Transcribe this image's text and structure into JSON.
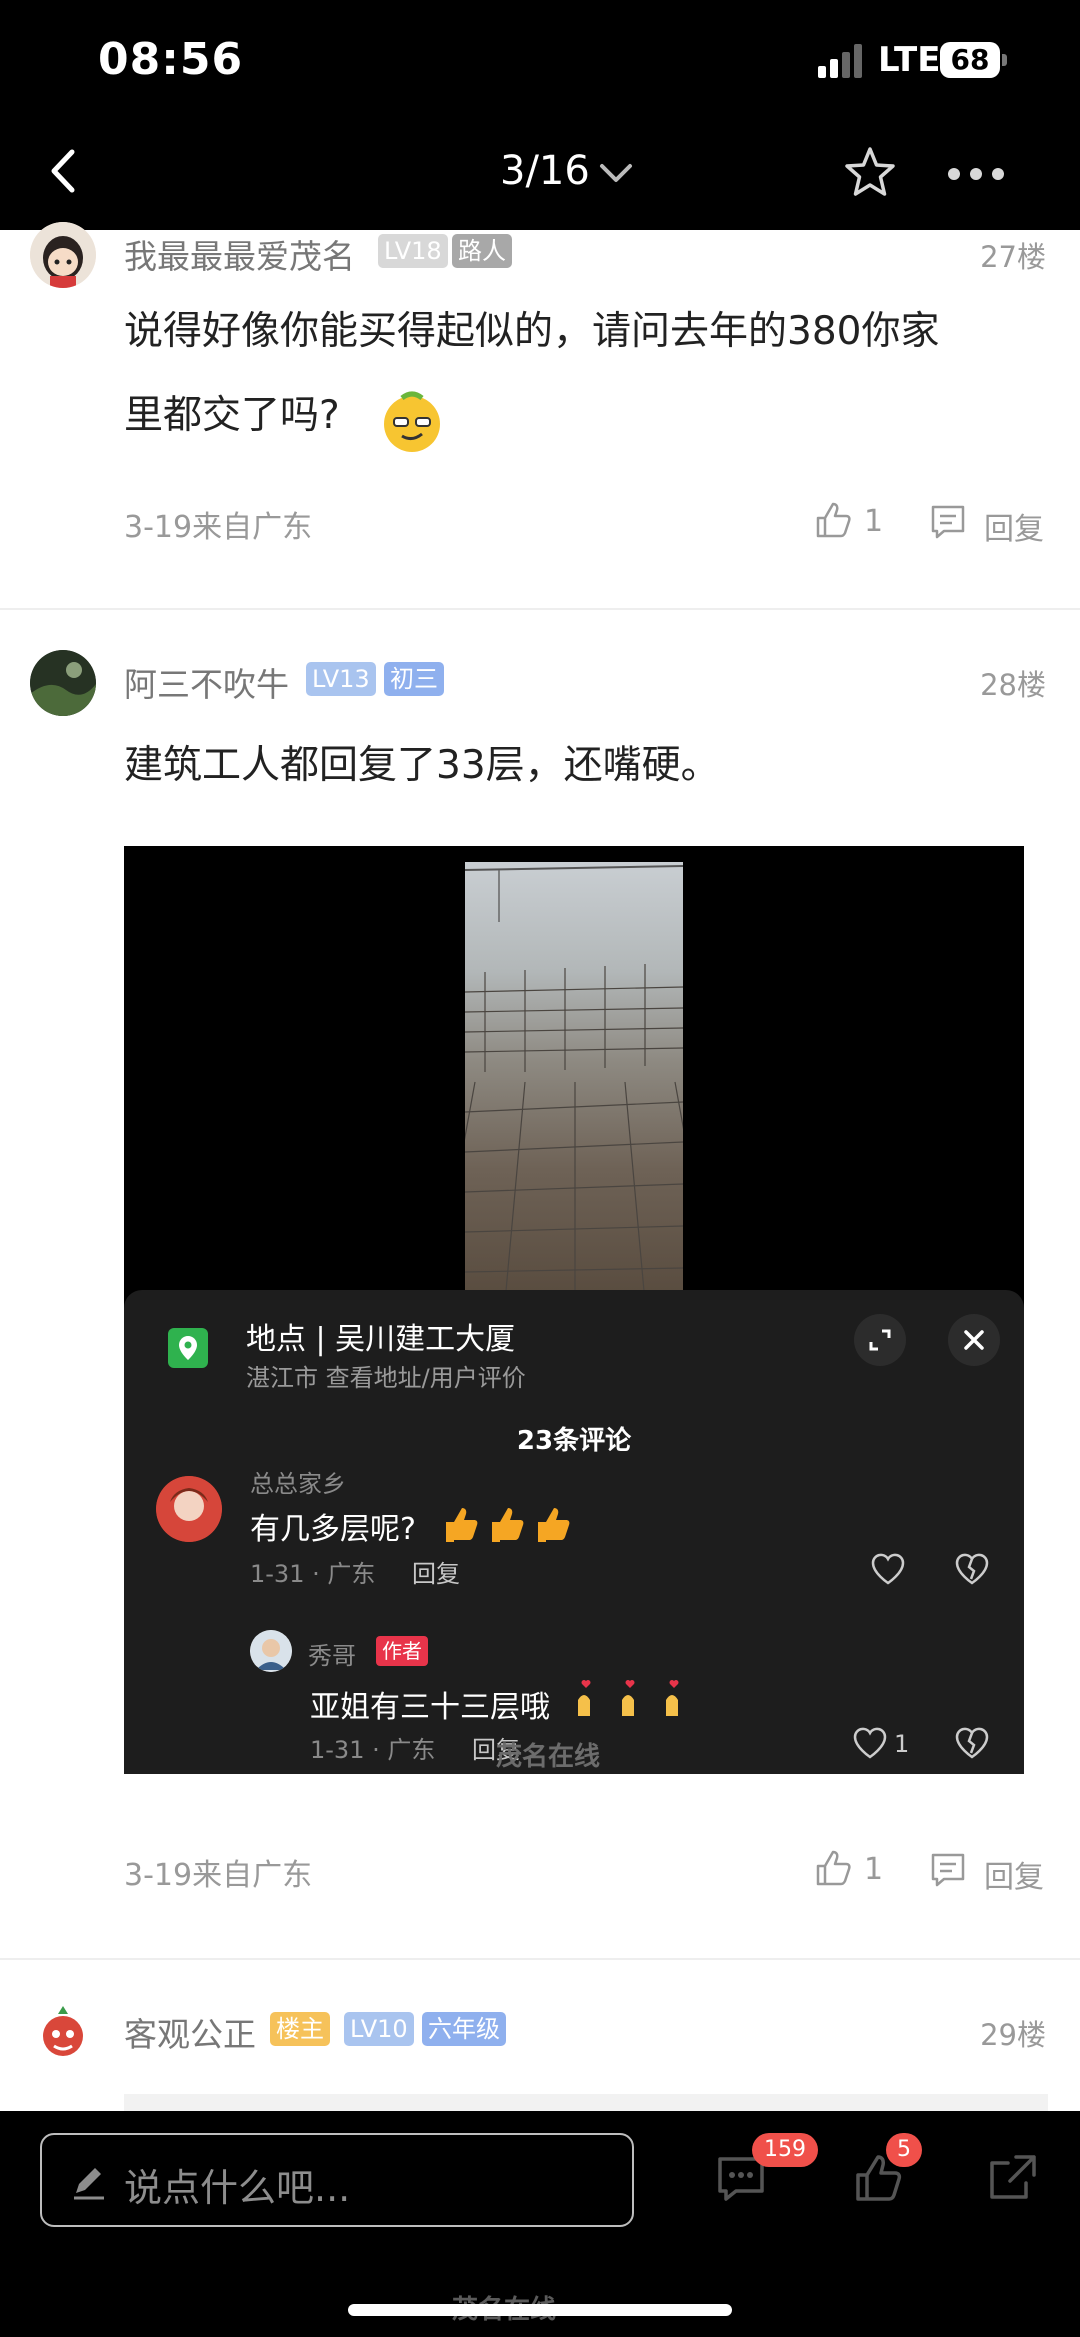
{
  "status": {
    "time": "08:56",
    "network": "LTE",
    "battery": "68"
  },
  "nav": {
    "title": "3/16"
  },
  "posts": [
    {
      "username": "我最最最爱茂名",
      "badges": [
        "LV18",
        "路人"
      ],
      "floor": "27楼",
      "text_line1": "说得好像你能买得起似的，请问去年的380你家",
      "text_line2": "里都交了吗?",
      "meta": "3-19来自广东",
      "likes": "1",
      "reply_label": "回复"
    },
    {
      "username": "阿三不吹牛",
      "badges": [
        "LV13",
        "初三"
      ],
      "floor": "28楼",
      "text": "建筑工人都回复了33层，还嘴硬。",
      "meta": "3-19来自广东",
      "likes": "1",
      "reply_label": "回复"
    },
    {
      "username": "客观公正",
      "badges": [
        "楼主",
        "LV10",
        "六年级"
      ],
      "floor": "29楼"
    }
  ],
  "embedded": {
    "location_label": "地点 | 吴川建工大厦",
    "location_sub": "湛江市  查看地址/用户评价",
    "comment_count": "23条评论",
    "comments": [
      {
        "name": "总总家乡",
        "text": "有几多层呢?",
        "meta": "1-31 · 广东",
        "reply": "回复"
      },
      {
        "name": "秀哥",
        "tag": "作者",
        "text": "亚姐有三十三层哦",
        "meta": "1-31 · 广东",
        "reply": "回复",
        "likes": "1"
      }
    ],
    "watermark": "茂名在线"
  },
  "bottom": {
    "placeholder": "说点什么吧...",
    "comments_badge": "159",
    "likes_badge": "5",
    "watermark": "茂名在线"
  },
  "colors": {
    "lv_badge": "#a9c4ef",
    "role_badge": "#a8a8a8",
    "grade_badge": "#8fb0ee",
    "owner_badge": "#f6c25a"
  }
}
